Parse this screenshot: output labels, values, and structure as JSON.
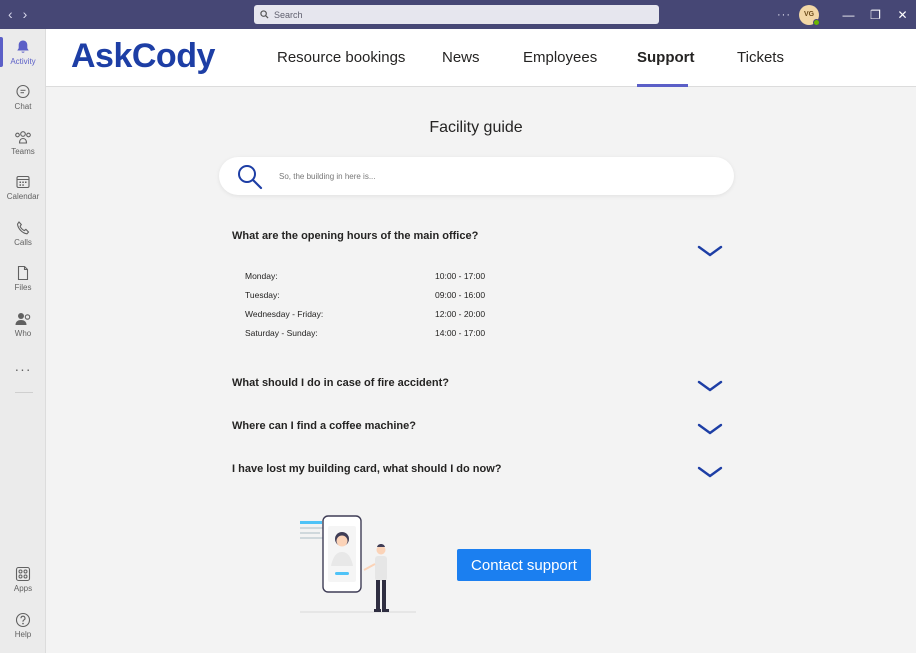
{
  "titlebar": {
    "search_placeholder": "Search",
    "more_label": "···",
    "avatar_initials": "VG",
    "minimize": "—",
    "maximize": "❐",
    "close": "✕"
  },
  "rail": {
    "items": [
      {
        "label": "Activity",
        "icon": "bell-icon"
      },
      {
        "label": "Chat",
        "icon": "chat-icon"
      },
      {
        "label": "Teams",
        "icon": "teams-icon"
      },
      {
        "label": "Calendar",
        "icon": "calendar-icon"
      },
      {
        "label": "Calls",
        "icon": "phone-icon"
      },
      {
        "label": "Files",
        "icon": "file-icon"
      },
      {
        "label": "Who",
        "icon": "people-icon"
      },
      {
        "label": "Apps",
        "icon": "apps-icon"
      },
      {
        "label": "Help",
        "icon": "help-icon"
      }
    ],
    "more_label": "···"
  },
  "app": {
    "logo": "AskCody",
    "tabs": [
      "Resource bookings",
      "News",
      "Employees",
      "Support",
      "Tickets"
    ],
    "active_tab": "Support"
  },
  "main": {
    "title": "Facility guide",
    "search_placeholder": "So, the building in here is...",
    "faq": [
      {
        "question": "What are the opening hours of the main office?"
      },
      {
        "question": "What should I do in case of fire accident?"
      },
      {
        "question": "Where can I find a coffee machine?"
      },
      {
        "question": "I have lost my building card, what should I do now?"
      }
    ],
    "hours": [
      {
        "day": "Monday:",
        "time": "10:00 - 17:00"
      },
      {
        "day": "Tuesday:",
        "time": "09:00 - 16:00"
      },
      {
        "day": "Wednesday - Friday:",
        "time": "12:00 - 20:00"
      },
      {
        "day": "Saturday - Sunday:",
        "time": "14:00 - 17:00"
      }
    ],
    "contact_button": "Contact support"
  },
  "colors": {
    "titlebar": "#464775",
    "brand": "#1d3ea5",
    "accent": "#5b5fc7",
    "button": "#1b7ff0"
  }
}
